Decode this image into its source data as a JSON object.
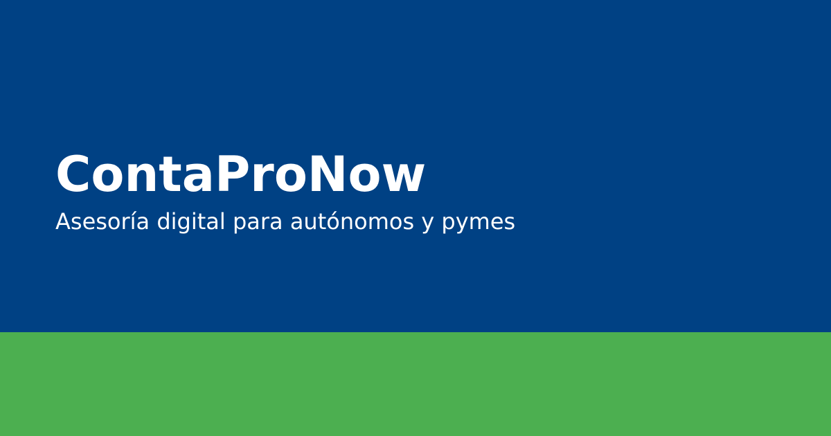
{
  "banner": {
    "title": "ContaProNow",
    "tagline": "Asesoría digital para autónomos y pymes"
  },
  "colors": {
    "primary_blue": "#004184",
    "accent_green": "#4caf50",
    "text": "#ffffff"
  }
}
